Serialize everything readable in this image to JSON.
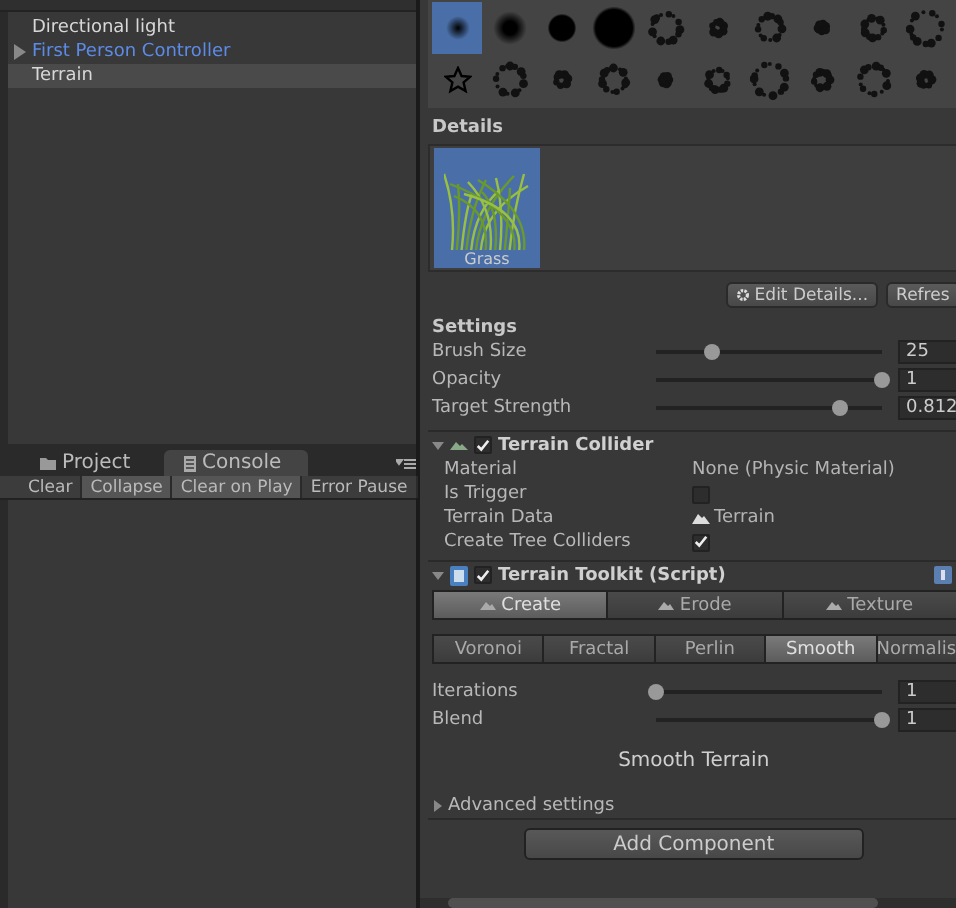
{
  "hierarchy": {
    "items": [
      {
        "label": "Directional light",
        "kind": "object",
        "selected": false
      },
      {
        "label": "First Person Controller",
        "kind": "prefab",
        "selected": false
      },
      {
        "label": "Terrain",
        "kind": "object",
        "selected": true
      }
    ]
  },
  "bottom_tabs": [
    {
      "label": "Project",
      "selected": false
    },
    {
      "label": "Console",
      "selected": true
    }
  ],
  "console_toolbar": [
    {
      "label": "Clear",
      "on": false
    },
    {
      "label": "Collapse",
      "on": true
    },
    {
      "label": "Clear on Play",
      "on": true
    },
    {
      "label": "Error Pause",
      "on": false
    }
  ],
  "brushes": [
    {
      "selected": true
    },
    {
      "selected": false
    },
    {
      "selected": false
    },
    {
      "selected": false
    },
    {
      "selected": false
    },
    {
      "selected": false
    },
    {
      "selected": false
    },
    {
      "selected": false
    },
    {
      "selected": false
    },
    {
      "selected": false
    },
    {
      "selected": false
    },
    {
      "selected": false
    },
    {
      "selected": false
    },
    {
      "selected": false
    },
    {
      "selected": false
    },
    {
      "selected": false
    },
    {
      "selected": false
    },
    {
      "selected": false
    },
    {
      "selected": false
    },
    {
      "selected": false
    }
  ],
  "details": {
    "title": "Details",
    "items": [
      {
        "label": "Grass",
        "selected": true
      }
    ],
    "buttons": [
      "Edit Details...",
      "Refres"
    ]
  },
  "settings": {
    "title": "Settings",
    "sliders": [
      {
        "label": "Brush Size",
        "level": 0.25,
        "value": "25"
      },
      {
        "label": "Opacity",
        "level": 1,
        "value": "1"
      },
      {
        "label": "Target Strength",
        "level": 0.81,
        "value": "0.812"
      }
    ]
  },
  "terrain_collider": {
    "title": "Terrain Collider",
    "enabled": true,
    "expanded": true,
    "fields": [
      {
        "label": "Material",
        "kind": "text",
        "value": "None (Physic Material)"
      },
      {
        "label": "Is Trigger",
        "kind": "checkbox",
        "checked": false
      },
      {
        "label": "Terrain Data",
        "kind": "asset",
        "value": "Terrain"
      },
      {
        "label": "Create Tree Colliders",
        "kind": "checkbox",
        "checked": true
      }
    ]
  },
  "terrain_toolkit": {
    "title": "Terrain Toolkit (Script)",
    "enabled": true,
    "expanded": true,
    "main_tabs": [
      {
        "label": "Create",
        "selected": true
      },
      {
        "label": "Erode",
        "selected": false
      },
      {
        "label": "Texture",
        "selected": false
      }
    ],
    "sub_tabs": [
      {
        "label": "Voronoi",
        "selected": false
      },
      {
        "label": "Fractal",
        "selected": false
      },
      {
        "label": "Perlin",
        "selected": false
      },
      {
        "label": "Smooth",
        "selected": true
      },
      {
        "label": "Normalis",
        "selected": false
      }
    ],
    "sliders": [
      {
        "label": "Iterations",
        "level": 0,
        "value": "1"
      },
      {
        "label": "Blend",
        "level": 1,
        "value": "1"
      }
    ],
    "action": "Smooth Terrain",
    "advanced": {
      "label": "Advanced settings",
      "expanded": false
    }
  },
  "add_component": "Add Component"
}
